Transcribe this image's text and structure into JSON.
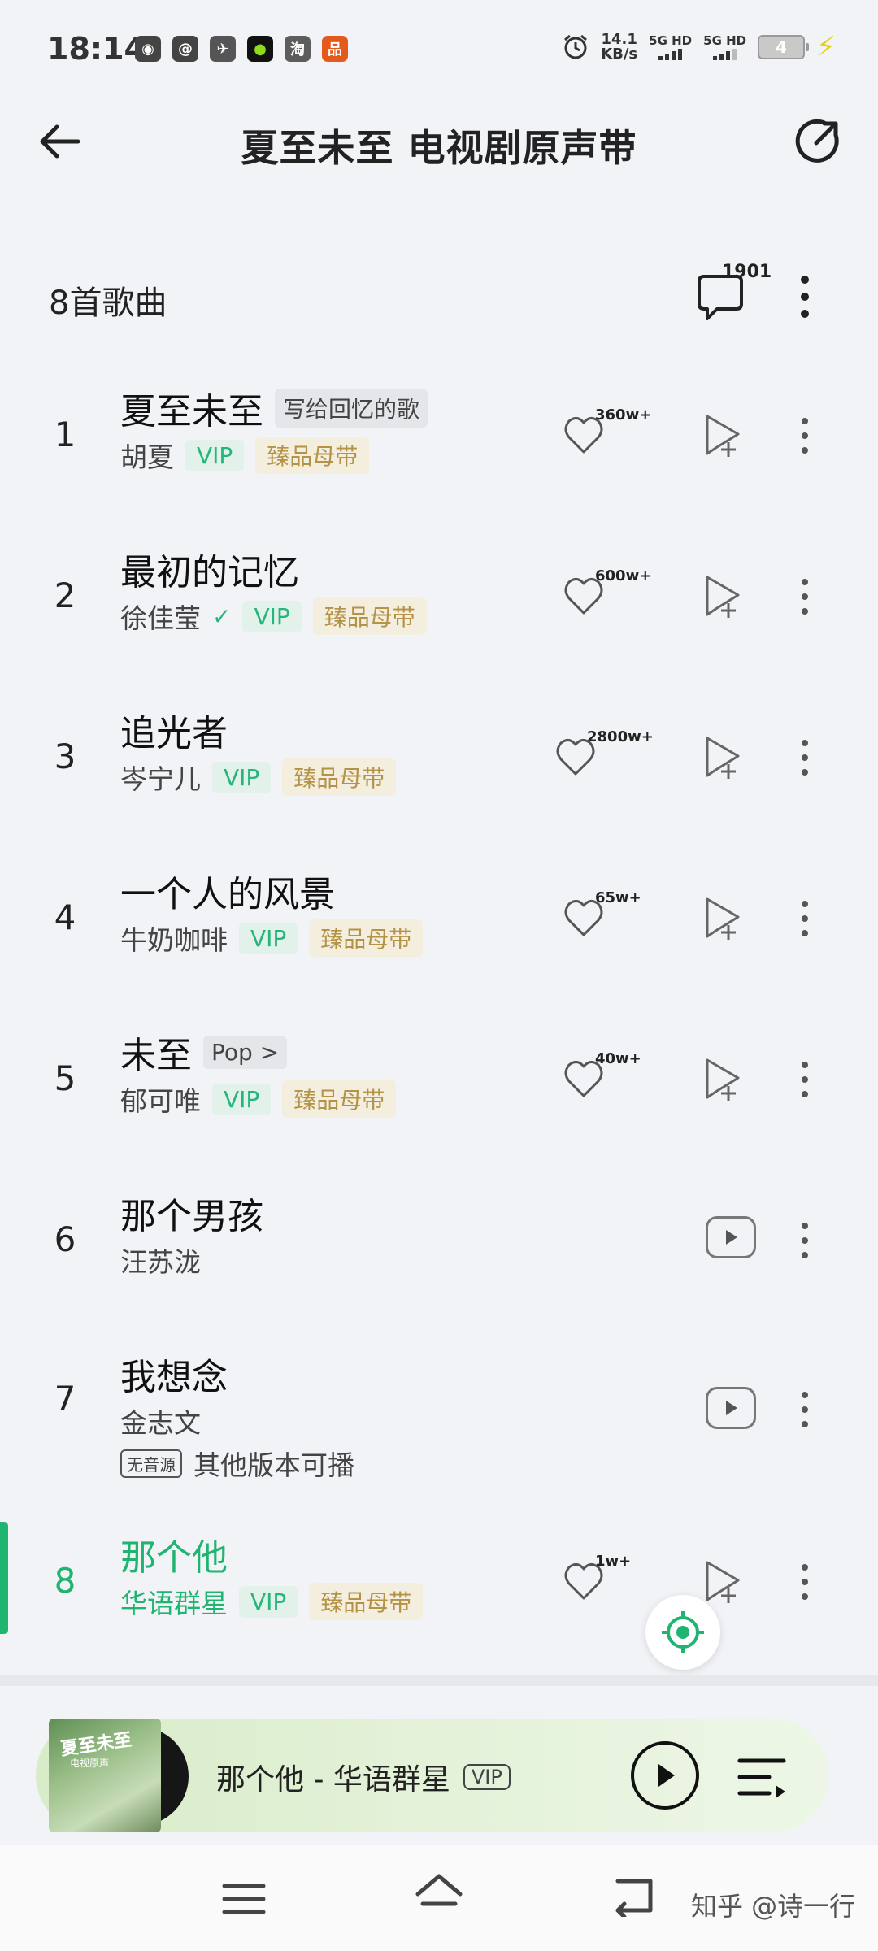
{
  "status_bar": {
    "time": "18:14",
    "apps": [
      "◉",
      "@",
      "✈",
      "●",
      "淘",
      "品"
    ],
    "net_speed": "14.1",
    "net_unit": "KB/s",
    "sim1": "5G HD",
    "sim2": "5G HD",
    "battery": "4"
  },
  "header": {
    "title": "夏至未至 电视剧原声带"
  },
  "list": {
    "count_label": "8首歌曲",
    "comment_count": "1901"
  },
  "songs": [
    {
      "index": "1",
      "title": "夏至未至",
      "tag": "写给回忆的歌",
      "artist": "胡夏",
      "vip": "VIP",
      "quality": "臻品母带",
      "likes": "360w+"
    },
    {
      "index": "2",
      "title": "最初的记忆",
      "artist": "徐佳莹",
      "verified": "✓",
      "vip": "VIP",
      "quality": "臻品母带",
      "likes": "600w+"
    },
    {
      "index": "3",
      "title": "追光者",
      "artist": "岑宁儿",
      "vip": "VIP",
      "quality": "臻品母带",
      "likes": "2800w+"
    },
    {
      "index": "4",
      "title": "一个人的风景",
      "artist": "牛奶咖啡",
      "vip": "VIP",
      "quality": "臻品母带",
      "likes": "65w+"
    },
    {
      "index": "5",
      "title": "未至",
      "tag": "Pop >",
      "artist": "郁可唯",
      "vip": "VIP",
      "quality": "臻品母带",
      "likes": "40w+"
    },
    {
      "index": "6",
      "title": "那个男孩",
      "artist": "汪苏泷"
    },
    {
      "index": "7",
      "title": "我想念",
      "artist": "金志文",
      "no_source_badge": "无音源",
      "alt_text": "其他版本可播"
    },
    {
      "index": "8",
      "title": "那个他",
      "artist": "华语群星",
      "vip": "VIP",
      "quality": "臻品母带",
      "likes": "1w+"
    }
  ],
  "player": {
    "peek": "#",
    "cover_title": "夏至未至",
    "cover_sub": "电视原声",
    "now_playing": "那个他 - 华语群星",
    "vip": "VIP"
  },
  "watermark": "知乎 @诗一行",
  "colors": {
    "accent": "#1fb46f",
    "vip_text": "#25b67a",
    "master_text": "#b49246",
    "background": "#f1f3f7"
  }
}
